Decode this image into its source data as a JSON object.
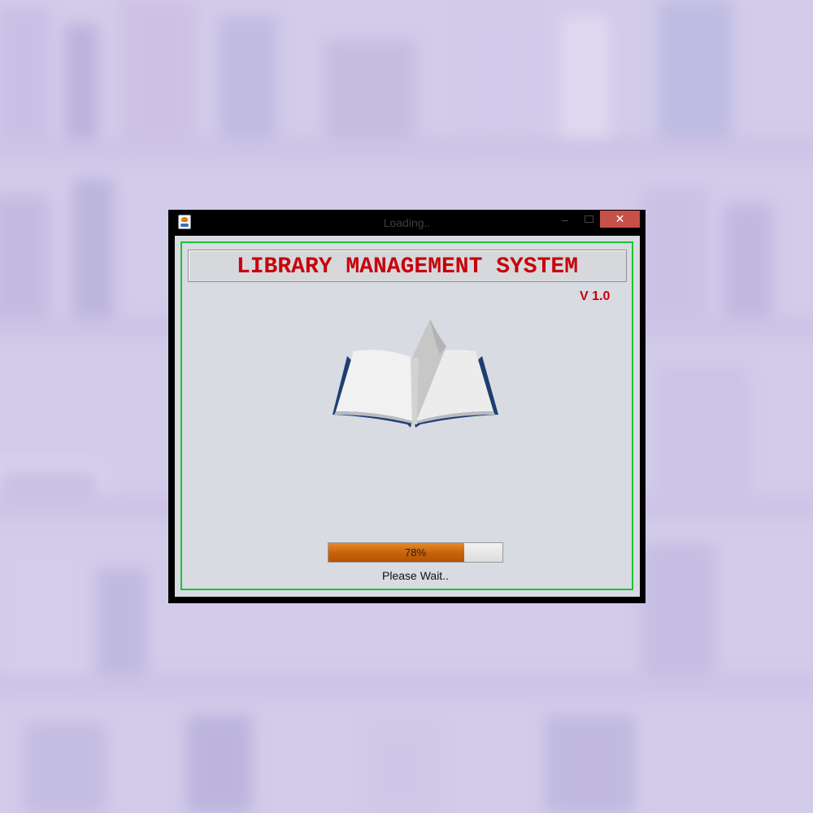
{
  "window": {
    "title": "Loading..",
    "minimize_glyph": "–",
    "close_glyph": "✕"
  },
  "app": {
    "title": "LIBRARY MANAGEMENT SYSTEM",
    "version": "V 1.0"
  },
  "progress": {
    "value": 78,
    "label": "78%",
    "status": "Please Wait.."
  },
  "colors": {
    "title_red": "#c8000a",
    "frame_green": "#19c430",
    "progress_orange": "#c8610a",
    "close_red": "#c7504a"
  },
  "icons": [
    "java-app-icon",
    "minimize-icon",
    "maximize-icon",
    "close-icon",
    "open-book-icon"
  ]
}
